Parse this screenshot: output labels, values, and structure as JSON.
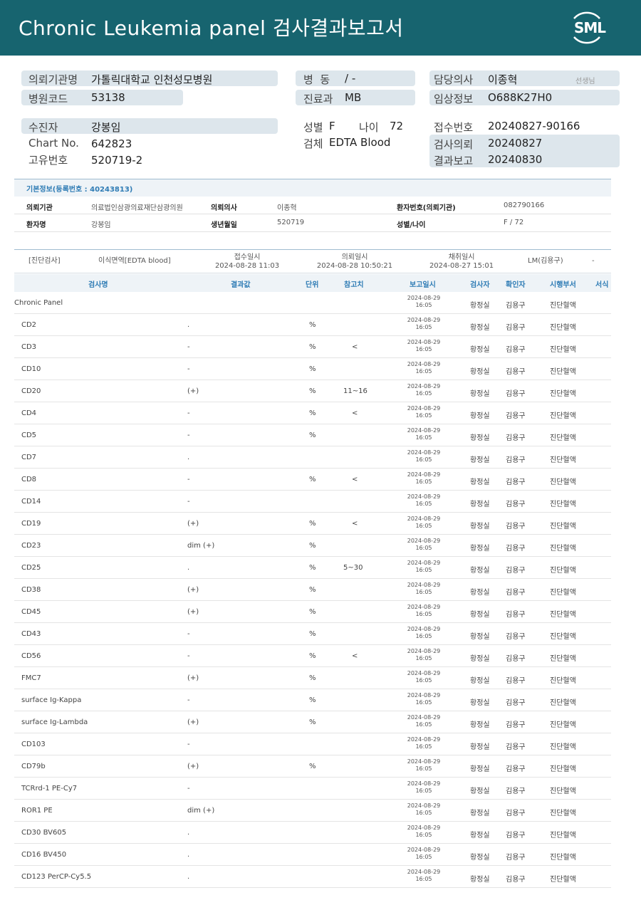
{
  "header": {
    "title": "Chronic  Leukemia  panel 검사결과보고서",
    "logo_text": "SML"
  },
  "patient_block": {
    "requesting_org_label": "의뢰기관명",
    "requesting_org_value": "가톨릭대학교 인천성모병원",
    "hospital_code_label": "병원코드",
    "hospital_code_value": "53138",
    "ward_label": "병  동",
    "ward_value": "/ -",
    "dept_label": "진료과",
    "dept_value": "MB",
    "doctor_label": "담당의사",
    "doctor_value": "이종혁",
    "doctor_suffix": "선생님",
    "clinical_info_label": "임상정보",
    "clinical_info_value": "O688K27H0",
    "patient_label": "수진자",
    "patient_value": "강봉임",
    "chart_label": "Chart No.",
    "chart_value": "642823",
    "unique_label": "고유번호",
    "unique_value": "520719-2",
    "sex_label": "성별",
    "sex_value": "F",
    "age_label": "나이",
    "age_value": "72",
    "specimen_label": "검체",
    "specimen_value": "EDTA Blood",
    "receipt_no_label": "접수번호",
    "receipt_no_value": "20240827-90166",
    "test_request_label": "검사의뢰",
    "test_request_value": "20240827",
    "result_report_label": "결과보고",
    "result_report_value": "20240830"
  },
  "basic_info": {
    "section_title": "기본정보(등록번호 : 40243813)",
    "org_label": "의뢰기관",
    "org_value": "의료법인삼광의료재단삼광의원",
    "doctor_label": "의뢰의사",
    "doctor_value": "이종혁",
    "patient_no_label": "환자번호(의뢰기관)",
    "patient_no_value": "082790166",
    "patient_label": "환자명",
    "patient_value": "강봉임",
    "birth_label": "생년월일",
    "birth_value": "520719",
    "sex_age_label": "성별/나이",
    "sex_age_value": "F / 72"
  },
  "test_header": {
    "category": "[진단검사]",
    "specimen": "이식면역[EDTA blood]",
    "receipt_label": "접수일시",
    "receipt_value": "2024-08-28 11:03",
    "request_label": "의뢰일시",
    "request_value": "2024-08-28 10:50:21",
    "collect_label": "채취일시",
    "collect_value": "2024-08-27 15:01",
    "lab": "LM(김용구)",
    "dash": "-"
  },
  "columns": {
    "name": "검사명",
    "result": "결과값",
    "unit": "단위",
    "ref": "참고치",
    "report_time": "보고일시",
    "tester": "검사자",
    "confirmer": "확인자",
    "dept": "시행부서",
    "form": "서식"
  },
  "report_date": "2024-08-29",
  "report_time": "16:05",
  "tester": "황정실",
  "confirmer": "김용구",
  "dept": "진단혈액",
  "rows": [
    {
      "name": "Chronic Panel",
      "result": "",
      "unit": "",
      "ref": "",
      "top": true
    },
    {
      "name": "CD2",
      "result": ".",
      "unit": "%",
      "ref": ""
    },
    {
      "name": "CD3",
      "result": "-",
      "unit": "%",
      "ref": "<"
    },
    {
      "name": "CD10",
      "result": "-",
      "unit": "%",
      "ref": ""
    },
    {
      "name": "CD20",
      "result": "(+)",
      "unit": "%",
      "ref": "11~16"
    },
    {
      "name": "CD4",
      "result": "-",
      "unit": "%",
      "ref": "<"
    },
    {
      "name": "CD5",
      "result": "-",
      "unit": "%",
      "ref": ""
    },
    {
      "name": "CD7",
      "result": ".",
      "unit": "",
      "ref": ""
    },
    {
      "name": "CD8",
      "result": "-",
      "unit": "%",
      "ref": "<"
    },
    {
      "name": "CD14",
      "result": "-",
      "unit": "",
      "ref": ""
    },
    {
      "name": "CD19",
      "result": "(+)",
      "unit": "%",
      "ref": "<"
    },
    {
      "name": "CD23",
      "result": "dim (+)",
      "unit": "%",
      "ref": ""
    },
    {
      "name": "CD25",
      "result": ".",
      "unit": "%",
      "ref": "5~30"
    },
    {
      "name": "CD38",
      "result": "(+)",
      "unit": "%",
      "ref": ""
    },
    {
      "name": "CD45",
      "result": "(+)",
      "unit": "%",
      "ref": ""
    },
    {
      "name": "CD43",
      "result": "-",
      "unit": "%",
      "ref": ""
    },
    {
      "name": "CD56",
      "result": "-",
      "unit": "%",
      "ref": "<"
    },
    {
      "name": "FMC7",
      "result": "(+)",
      "unit": "%",
      "ref": ""
    },
    {
      "name": "surface Ig-Kappa",
      "result": "-",
      "unit": "%",
      "ref": ""
    },
    {
      "name": "surface Ig-Lambda",
      "result": "(+)",
      "unit": "%",
      "ref": ""
    },
    {
      "name": "CD103",
      "result": "-",
      "unit": "",
      "ref": ""
    },
    {
      "name": "CD79b",
      "result": "(+)",
      "unit": "%",
      "ref": ""
    },
    {
      "name": "TCRrd-1 PE-Cy7",
      "result": "-",
      "unit": "",
      "ref": ""
    },
    {
      "name": "ROR1 PE",
      "result": "dim (+)",
      "unit": "",
      "ref": ""
    },
    {
      "name": "CD30 BV605",
      "result": ".",
      "unit": "",
      "ref": ""
    },
    {
      "name": "CD16 BV450",
      "result": ".",
      "unit": "",
      "ref": ""
    },
    {
      "name": "CD123 PerCP-Cy5.5",
      "result": ".",
      "unit": "",
      "ref": ""
    }
  ]
}
